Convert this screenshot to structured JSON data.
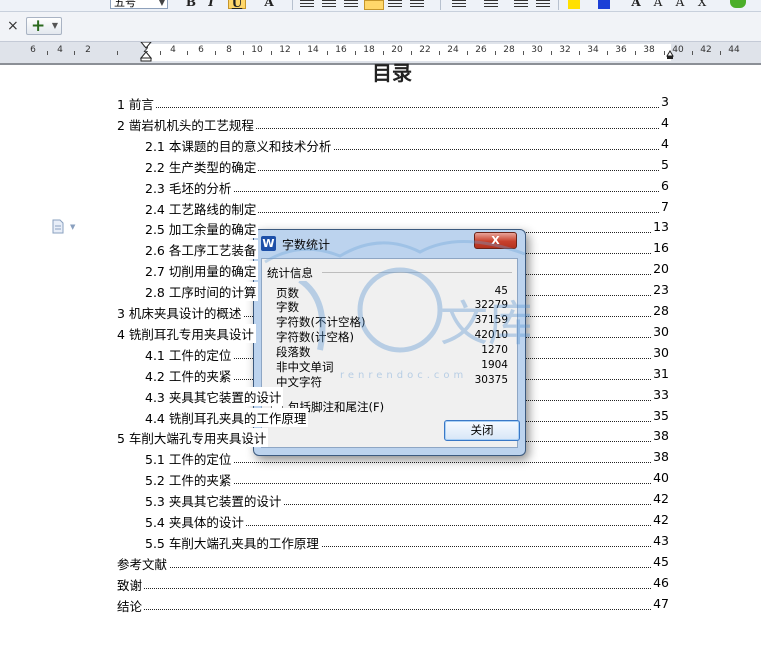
{
  "toolbar": {
    "font_size": "五号",
    "buttons": [
      "B",
      "I",
      "U",
      "A",
      "A",
      "A",
      "A",
      "X"
    ]
  },
  "tabbar": {
    "close_glyph": "×",
    "new_tab_glyph": "+"
  },
  "ruler": {
    "numbers": [
      "6",
      "4",
      "2",
      "2",
      "4",
      "6",
      "8",
      "10",
      "12",
      "14",
      "16",
      "18",
      "20",
      "22",
      "24",
      "26",
      "28",
      "30",
      "32",
      "34",
      "36",
      "38",
      "40",
      "42",
      "44"
    ]
  },
  "document": {
    "title": "目录",
    "toc": [
      {
        "label": "1  前言",
        "page": "3",
        "level": 1
      },
      {
        "label": "2  凿岩机机头的工艺规程",
        "page": "4",
        "level": 1
      },
      {
        "label": "2.1  本课题的目的意义和技术分析",
        "page": "4",
        "level": 2
      },
      {
        "label": "2.2  生产类型的确定",
        "page": "5",
        "level": 2
      },
      {
        "label": "2.3  毛坯的分析",
        "page": "6",
        "level": 2
      },
      {
        "label": "2.4  工艺路线的制定",
        "page": "7",
        "level": 2
      },
      {
        "label": "2.5  加工余量的确定",
        "page": "13",
        "level": 2
      },
      {
        "label": "2.6  各工序工艺装备",
        "page": "16",
        "level": 2
      },
      {
        "label": "2.7  切削用量的确定",
        "page": "20",
        "level": 2
      },
      {
        "label": "2.8  工序时间的计算",
        "page": "23",
        "level": 2
      },
      {
        "label": "3  机床夹具设计的概述",
        "page": "28",
        "level": 1
      },
      {
        "label": "4  铣削耳孔专用夹具设计",
        "page": "30",
        "level": 1
      },
      {
        "label": "4.1  工件的定位",
        "page": "30",
        "level": 2
      },
      {
        "label": "4.2  工件的夹紧",
        "page": "31",
        "level": 2
      },
      {
        "label": "4.3  夹具其它装置的设计",
        "page": "33",
        "level": 2
      },
      {
        "label": "4.4  铣削耳孔夹具的工作原理",
        "page": "35",
        "level": 2
      },
      {
        "label": "5  车削大端孔专用夹具设计",
        "page": "38",
        "level": 1
      },
      {
        "label": "5.1  工件的定位",
        "page": "38",
        "level": 2
      },
      {
        "label": "5.2  工件的夹紧",
        "page": "40",
        "level": 2
      },
      {
        "label": "5.3  夹具其它装置的设计",
        "page": "42",
        "level": 2
      },
      {
        "label": "5.4  夹具体的设计",
        "page": "42",
        "level": 2
      },
      {
        "label": "5.5  车削大端孔夹具的工作原理",
        "page": "43",
        "level": 2
      },
      {
        "label": "参考文献",
        "page": "45",
        "level": 0
      },
      {
        "label": "致谢",
        "page": "46",
        "level": 0
      },
      {
        "label": "结论",
        "page": "47",
        "level": 0
      }
    ]
  },
  "dialog": {
    "title": "字数统计",
    "close_glyph": "X",
    "group_label": "统计信息",
    "stats": [
      {
        "name": "页数",
        "value": "45"
      },
      {
        "name": "字数",
        "value": "32279"
      },
      {
        "name": "字符数(不计空格)",
        "value": "37159"
      },
      {
        "name": "字符数(计空格)",
        "value": "42010"
      },
      {
        "name": "段落数",
        "value": "1270"
      },
      {
        "name": "非中文单词",
        "value": "1904"
      },
      {
        "name": "中文字符",
        "value": "30375"
      }
    ],
    "footnote_label": "包括脚注和尾注(F)",
    "footnote_checked": false,
    "ok_label": "关闭"
  },
  "watermark": {
    "text": "文库",
    "url_text": "renrendoc.com"
  },
  "colors": {
    "dialog_frame": "#bcd3ee",
    "close_red": "#c8412c",
    "wps_blue": "#1d4fa8"
  }
}
